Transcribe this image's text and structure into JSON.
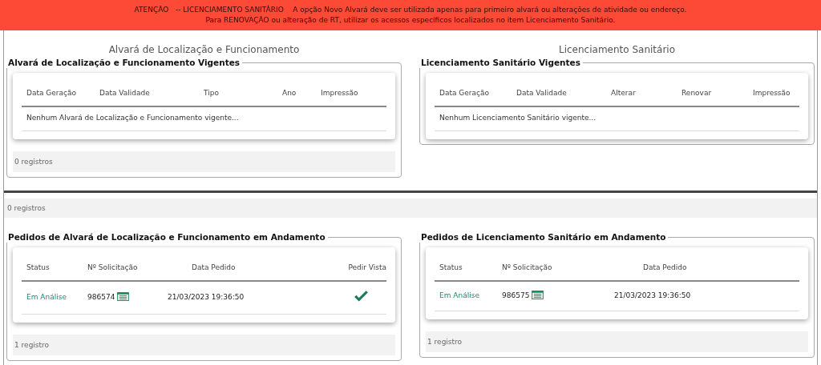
{
  "banner": {
    "lines": [
      "ATENÇÃO   -- LICENCIAMENTO SANITÁRIO    A opção Novo Alvará deve ser utilizada apenas para primeiro alvará ou alterações de atividade ou endereço.",
      "Para RENOVAÇÃO ou alteração de RT, utilizar os acessos específicos localizados no item Licenciamento Sanitário."
    ]
  },
  "current": [
    {
      "heading": "Alvará de Localização e Funcionamento",
      "legend": "Alvará de Localização e Funcionamento Vigentes",
      "columns": [
        "Data Geração",
        "Data Validade",
        "Tipo",
        "Ano",
        "Impressão"
      ],
      "empty_message": "Nenhum Alvará de Localização e Funcionamento vigente...",
      "footer": "0 registros"
    },
    {
      "heading": "Licenciamento Sanitário",
      "legend": "Licenciamento Sanitário Vigentes",
      "columns": [
        "Data Geração",
        "Data Validade",
        "Alterar",
        "Renovar",
        "Impressão"
      ],
      "empty_message": "Nenhum Licenciamento Sanitário vigente..."
    }
  ],
  "middle_footer": "0 registros",
  "requests": [
    {
      "legend": "Pedidos de Alvará de Localização e Funcionamento em Andamento",
      "columns": [
        "Status",
        "Nº Solicitação",
        "Data Pedido",
        "Pedir Vista"
      ],
      "rows": [
        {
          "status": "Em Análise",
          "number": "986574",
          "date": "21/03/2023 19:36:50",
          "pedir_vista": true
        }
      ],
      "footer": "1 registro"
    },
    {
      "legend": "Pedidos de Licenciamento Sanitário em Andamento",
      "columns": [
        "Status",
        "Nº Solicitação",
        "Data Pedido"
      ],
      "rows": [
        {
          "status": "Em Análise",
          "number": "986575",
          "date": "21/03/2023 19:36:50"
        }
      ],
      "footer": "1 registro"
    }
  ]
}
